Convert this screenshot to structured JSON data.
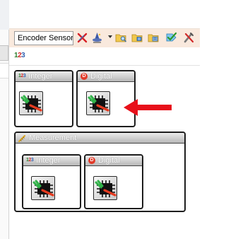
{
  "toolbar": {
    "sensor_value": "Encoder Sensor",
    "icons": [
      "x-tool-icon",
      "wizard-icon",
      "folder-search-icon",
      "folder-load-icon",
      "folder-config-icon",
      "check-tag-icon",
      "tools-icon"
    ]
  },
  "mini_toolbar": {
    "numbers_icon": [
      "1",
      "2",
      "3"
    ]
  },
  "blocks": {
    "integer": {
      "title": "Integer"
    },
    "digital": {
      "title": "Digital",
      "icon_letter": "D"
    },
    "measurement": {
      "title": "Measurement",
      "integer": {
        "title": "Integer"
      },
      "digital": {
        "title": "Digital",
        "icon_letter": "D"
      }
    }
  },
  "colors": {
    "toolbar_bg": "#f9e9dd",
    "arrow": "#e8101a",
    "block_border": "#1e1e1e",
    "header_gradient_top": "#ececec",
    "header_gradient_bottom": "#b7b7b7"
  }
}
